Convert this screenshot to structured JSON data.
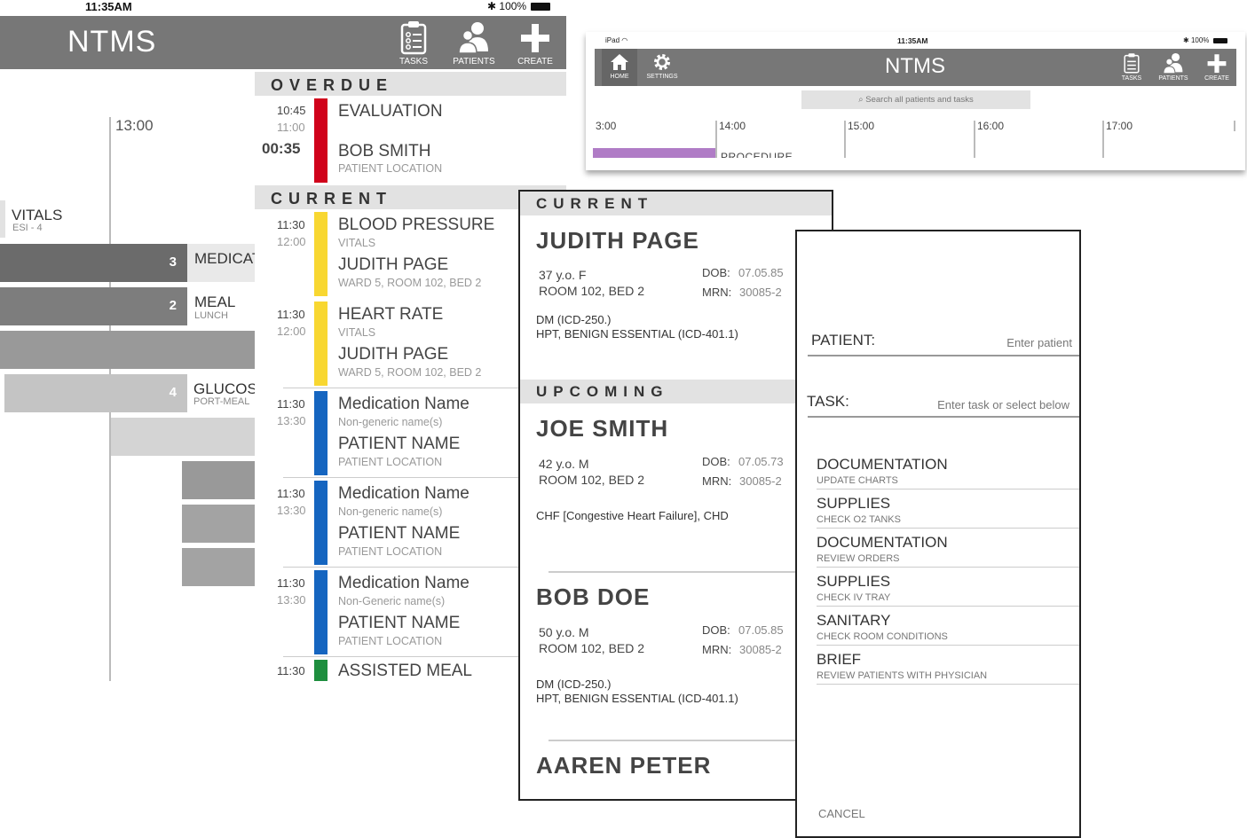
{
  "main": {
    "status": {
      "time": "11:35AM",
      "battery": "100%"
    },
    "title": "NTMS",
    "nav": {
      "tasks": "TASKS",
      "patients": "PATIENTS",
      "create": "CREATE"
    },
    "timeline": {
      "time_label": "13:00",
      "vitals": {
        "title": "VITALS",
        "sub": "ESI - 4"
      },
      "medication": {
        "num": "3",
        "title": "MEDICAT"
      },
      "meal": {
        "num": "2",
        "title": "MEAL",
        "sub": "LUNCH"
      },
      "glucose": {
        "num": "4",
        "title": "GLUCOS",
        "sub": "PORT-MEAL"
      }
    }
  },
  "tasks": {
    "overdue_heading": "OVERDUE",
    "current_heading": "CURRENT",
    "overdue": {
      "start": "10:45",
      "end": "11:00",
      "late": "00:35",
      "title": "EVALUATION",
      "patient": "BOB SMITH",
      "location": "PATIENT LOCATION",
      "color": "#d0021b"
    },
    "current": [
      {
        "start": "11:30",
        "end": "12:00",
        "title": "BLOOD PRESSURE",
        "sub": "VITALS",
        "patient": "JUDITH PAGE",
        "location": "WARD 5,  ROOM 102,  BED 2",
        "color": "#f8d731"
      },
      {
        "start": "11:30",
        "end": "12:00",
        "title": "HEART RATE",
        "sub": "VITALS",
        "patient": "JUDITH PAGE",
        "location": "WARD 5,  ROOM 102,  BED 2",
        "color": "#f8d731"
      },
      {
        "start": "11:30",
        "end": "13:30",
        "title": "Medication Name",
        "sub": "Non-generic name(s)",
        "patient": "PATIENT NAME",
        "location": "PATIENT LOCATION",
        "color": "#1565c0"
      },
      {
        "start": "11:30",
        "end": "13:30",
        "title": "Medication Name",
        "sub": "Non-generic name(s)",
        "patient": "PATIENT NAME",
        "location": "PATIENT LOCATION",
        "color": "#1565c0"
      },
      {
        "start": "11:30",
        "end": "13:30",
        "title": "Medication Name",
        "sub": "Non-Generic name(s)",
        "patient": "PATIENT NAME",
        "location": "PATIENT LOCATION",
        "color": "#1565c0"
      }
    ],
    "last": {
      "start": "11:30",
      "title": "ASSISTED MEAL",
      "color": "#1e8e3e"
    }
  },
  "patients": {
    "current_heading": "CURRENT",
    "upcoming_heading": "UPCOMING",
    "dob_label": "DOB:",
    "mrn_label": "MRN:",
    "current": {
      "name": "JUDITH PAGE",
      "age": "37 y.o.  F",
      "room": "ROOM 102,  BED 2",
      "dob": "07.05.85",
      "mrn": "30085-2",
      "dx1": "DM (ICD-250.)",
      "dx2": "HPT, BENIGN ESSENTIAL (ICD-401.1)"
    },
    "upcoming": [
      {
        "name": "JOE SMITH",
        "age": "42 y.o.  M",
        "room": "ROOM 102,  BED 2",
        "dob": "07.05.73",
        "mrn": "30085-2",
        "dx1": "CHF [Congestive Heart Failure], CHD",
        "dx2": ""
      },
      {
        "name": "BOB DOE",
        "age": "50 y.o.  M",
        "room": "ROOM 102,  BED 2",
        "dob": "07.05.85",
        "mrn": "30085-2",
        "dx1": "DM (ICD-250.)",
        "dx2": "HPT, BENIGN ESSENTIAL (ICD-401.1)"
      },
      {
        "name": "AAREN PETER",
        "age": "",
        "room": "",
        "dob": "",
        "mrn": "",
        "dx1": "",
        "dx2": ""
      }
    ]
  },
  "create": {
    "patient_label": "PATIENT:",
    "patient_placeholder": "Enter patient",
    "task_label": "TASK:",
    "task_placeholder": "Enter task or select below",
    "options": [
      {
        "title": "DOCUMENTATION",
        "sub": "UPDATE CHARTS"
      },
      {
        "title": "SUPPLIES",
        "sub": "CHECK O2 TANKS"
      },
      {
        "title": "DOCUMENTATION",
        "sub": "REVIEW ORDERS"
      },
      {
        "title": "SUPPLIES",
        "sub": "CHECK IV TRAY"
      },
      {
        "title": "SANITARY",
        "sub": "CHECK ROOM CONDITIONS"
      },
      {
        "title": "BRIEF",
        "sub": "REVIEW PATIENTS WITH PHYSICIAN"
      }
    ],
    "cancel": "CANCEL"
  },
  "ipad": {
    "status": {
      "device": "iPad",
      "time": "11:35AM",
      "battery": "100%"
    },
    "title": "NTMS",
    "nav": {
      "home": "HOME",
      "settings": "SETTINGS",
      "tasks": "TASKS",
      "patients": "PATIENTS",
      "create": "CREATE"
    },
    "search_placeholder": "Search all patients and tasks",
    "ticks": [
      "3:00",
      "14:00",
      "15:00",
      "16:00",
      "17:00"
    ],
    "procedures": "PROCEDURES",
    "procedures_color": "#b07cc6"
  }
}
